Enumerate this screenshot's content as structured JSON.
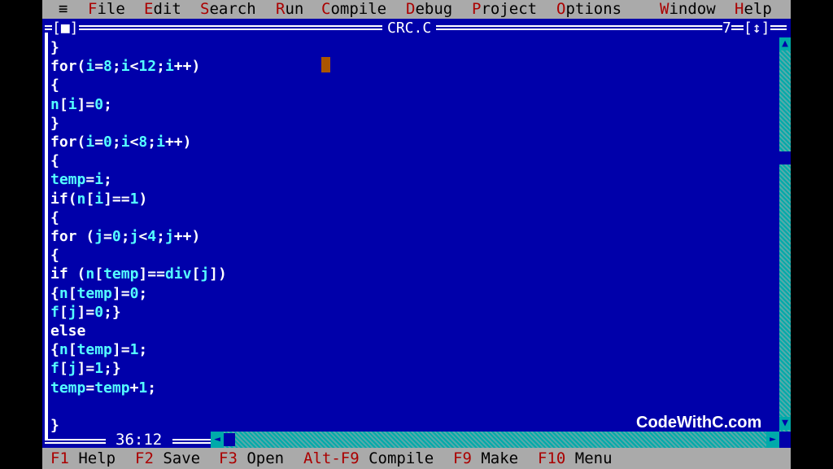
{
  "menubar": {
    "system_glyph": "≡",
    "items": [
      {
        "hot": "F",
        "rest": "ile"
      },
      {
        "hot": "E",
        "rest": "dit"
      },
      {
        "hot": "S",
        "rest": "earch"
      },
      {
        "hot": "R",
        "rest": "un"
      },
      {
        "hot": "C",
        "rest": "ompile"
      },
      {
        "hot": "D",
        "rest": "ebug"
      },
      {
        "hot": "P",
        "rest": "roject"
      },
      {
        "hot": "O",
        "rest": "ptions"
      },
      {
        "hot": "W",
        "rest": "indow"
      },
      {
        "hot": "H",
        "rest": "elp"
      }
    ]
  },
  "window": {
    "close_box": "[■]",
    "title": "CRC.C",
    "number": "7",
    "zoom_box": "[↕]",
    "cursor_position": "36:12"
  },
  "editor": {
    "lines": [
      "}",
      "for(i=8;i<12;i++)",
      "{",
      "n[i]=0;",
      "}",
      "for(i=0;i<8;i++)",
      "{",
      "temp=i;",
      "if(n[i]==1)",
      "{",
      "for (j=0;j<4;j++)",
      "{",
      "if (n[temp]==div[j])",
      "{n[temp]=0;",
      "f[j]=0;}",
      "else",
      "{n[temp]=1;",
      "f[j]=1;}",
      "temp=temp+1;",
      "",
      "}"
    ]
  },
  "watermark": "CodeWithC.com",
  "statusbar": {
    "items": [
      {
        "key": "F1",
        "label": "Help"
      },
      {
        "key": "F2",
        "label": "Save"
      },
      {
        "key": "F3",
        "label": "Open"
      },
      {
        "key": "Alt-F9",
        "label": "Compile"
      },
      {
        "key": "F9",
        "label": "Make"
      },
      {
        "key": "F10",
        "label": "Menu"
      }
    ]
  },
  "colors": {
    "background": "#0000aa",
    "menu_bar": "#aaaaaa",
    "hotkey": "#aa0000",
    "code_identifiers": "#55ffff",
    "code_keywords": "#ffffff",
    "cursor": "#aa5500"
  },
  "icons": {
    "scroll_up": "up-arrow-icon",
    "scroll_down": "down-arrow-icon",
    "scroll_left": "left-arrow-icon",
    "scroll_right": "right-arrow-icon"
  }
}
